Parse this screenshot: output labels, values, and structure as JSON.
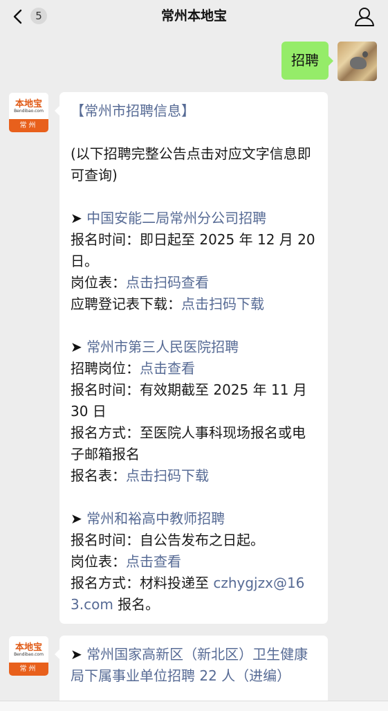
{
  "header": {
    "title": "常州本地宝",
    "unread_count": "5",
    "back_icon": "chevron-left-icon",
    "user_icon": "person-icon"
  },
  "sent_message": {
    "text": "招聘"
  },
  "bot_avatar": {
    "brand": "本地宝",
    "site": "Bendibao.com",
    "city": "常州"
  },
  "message1": {
    "heading": "【常州市招聘信息】",
    "intro": "(以下招聘完整公告点击对应文字信息即可查询)",
    "job1": {
      "arrow": "➤ ",
      "title": "中国安能二局常州分公司招聘",
      "time": "报名时间：即日起至 2025 年 12 月 20 日。",
      "positions_label": "岗位表：",
      "positions_link": "点击扫码查看",
      "form_label": "应聘登记表下载：",
      "form_link": "点击扫码下载"
    },
    "job2": {
      "arrow": "➤ ",
      "title": "常州市第三人民医院招聘",
      "positions_label": "招聘岗位：",
      "positions_link": "点击查看",
      "time": "报名时间：有效期截至 2025 年 11 月 30 日",
      "method": "报名方式：至医院人事科现场报名或电子邮箱报名",
      "form_label": "报名表：",
      "form_link": "点击扫码下载"
    },
    "job3": {
      "arrow": "➤ ",
      "title": "常州和裕高中教师招聘",
      "time": "报名时间：自公告发布之日起。",
      "positions_label": "岗位表：",
      "positions_link": "点击查看",
      "method_label": "报名方式：材料投递至 ",
      "email": "czhygjzx@163.com",
      "method_suffix": " 报名。"
    }
  },
  "message2": {
    "arrow": "➤ ",
    "title": "常州国家高新区（新北区）卫生健康局下属事业单位招聘 22 人（进编）"
  },
  "colors": {
    "background": "#ededed",
    "sent_bubble": "#95ec69",
    "link": "#576b95",
    "brand_orange": "#e8601c"
  }
}
